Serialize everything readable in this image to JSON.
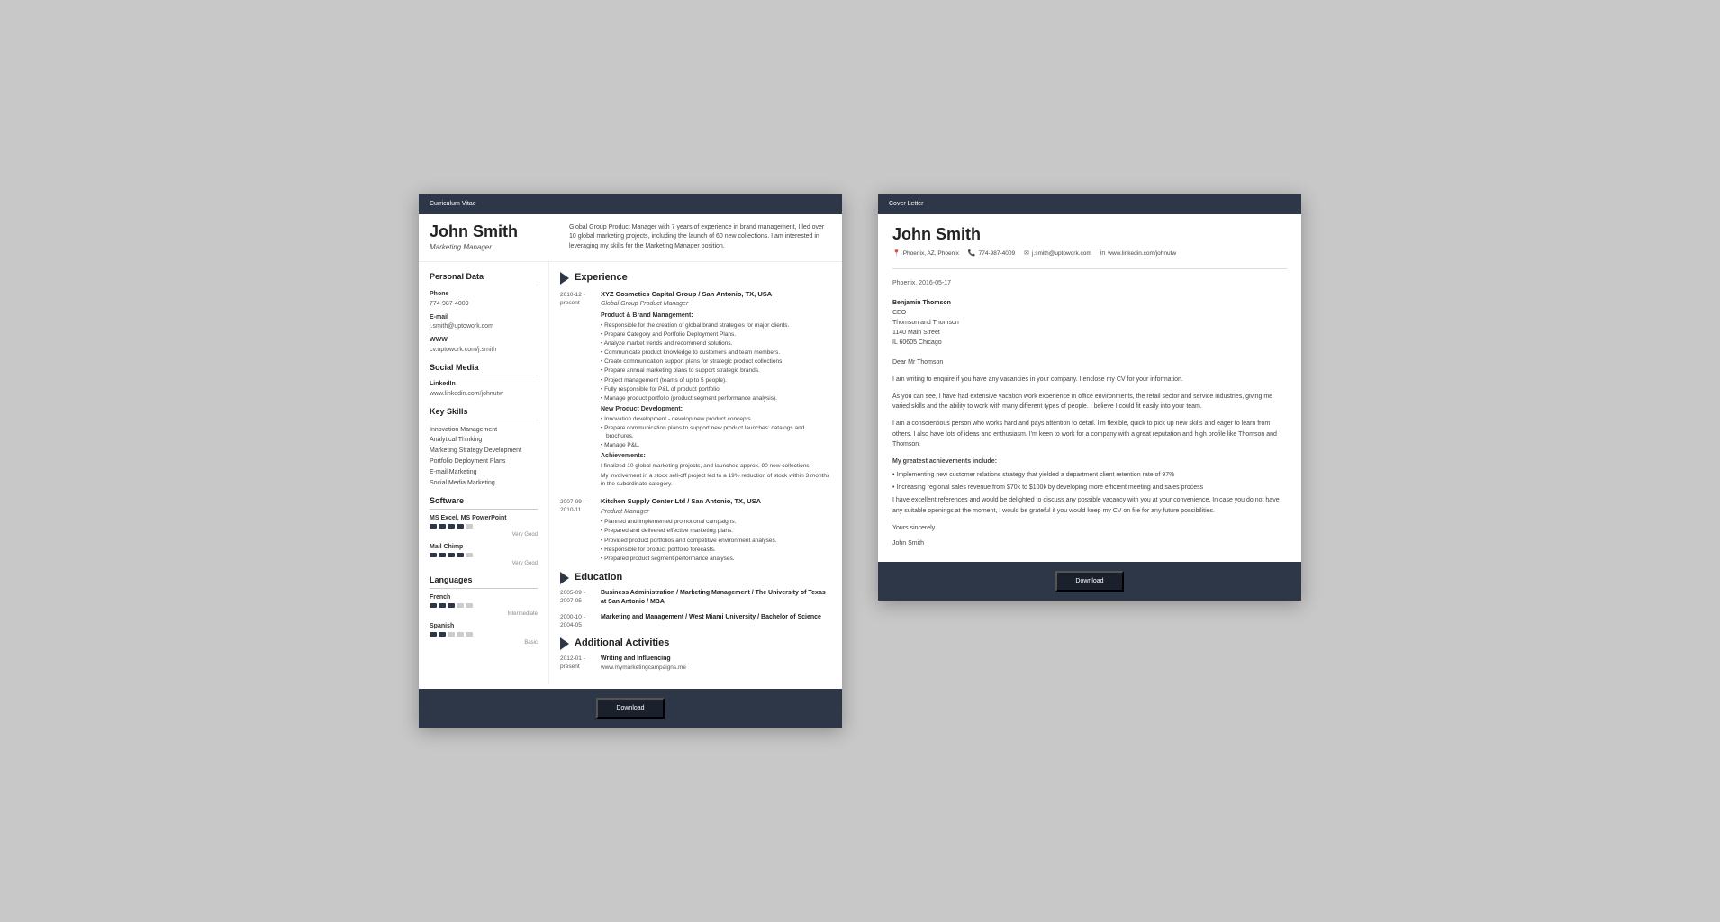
{
  "cv": {
    "header_bar": "Curriculum Vitae",
    "name": "John Smith",
    "title": "Marketing Manager",
    "summary": "Global Group Product Manager with 7 years of experience in brand management, I led over 10 global marketing projects, including the launch of 60 new collections. I am interested in leveraging my skills for the Marketing Manager position.",
    "personal_data": {
      "section_title": "Personal Data",
      "phone_label": "Phone",
      "phone": "774-987-4009",
      "email_label": "E-mail",
      "email": "j.smith@uptowork.com",
      "www_label": "WWW",
      "www": "cv.uptowork.com/j.smith"
    },
    "social_media": {
      "section_title": "Social Media",
      "linkedin_label": "LinkedIn",
      "linkedin": "www.linkedin.com/johnutw"
    },
    "key_skills": {
      "section_title": "Key Skills",
      "skills": [
        "Innovation Management",
        "Analytical Thinking",
        "Marketing Strategy Development",
        "Portfolio Deployment Plans",
        "E-mail Marketing",
        "Social Media Marketing"
      ]
    },
    "software": {
      "section_title": "Software",
      "items": [
        {
          "name": "MS Excel, MS PowerPoint",
          "rating": 4,
          "max": 5,
          "label": "Very Good"
        },
        {
          "name": "Mail Chimp",
          "rating": 4,
          "max": 5,
          "label": "Very Good"
        }
      ]
    },
    "languages": {
      "section_title": "Languages",
      "items": [
        {
          "name": "French",
          "rating": 3,
          "max": 5,
          "label": "Intermediate"
        },
        {
          "name": "Spanish",
          "rating": 2,
          "max": 5,
          "label": "Basic"
        }
      ]
    },
    "experience": {
      "section_title": "Experience",
      "entries": [
        {
          "date": "2010-12 - present",
          "company": "XYZ Cosmetics Capital Group / San Antonio, TX, USA",
          "role": "Global Group Product Manager",
          "sections": [
            {
              "label": "Product & Brand Management:",
              "bullets": [
                "• Responsible for the creation of global brand strategies for major clients.",
                "• Prepare Category and Portfolio Deployment Plans.",
                "• Analyze market trends and recommend solutions.",
                "• Communicate product knowledge to customers and team members.",
                "• Create communication support plans for strategic product collections.",
                "• Prepare annual marketing plans to support strategic brands.",
                "• Project management (teams of up to 5 people).",
                "• Fully responsible for P&L of product portfolio.",
                "• Manage product portfolio (product segment performance analysis)."
              ]
            },
            {
              "label": "New Product Development:",
              "bullets": [
                "• Innovation development - develop new product concepts.",
                "• Prepare communication plans to support new product launches: catalogs and brochures.",
                "• Manage P&L."
              ]
            }
          ],
          "achievements_label": "Achievements:",
          "achievements": [
            "I finalized 10 global marketing projects, and launched approx. 90 new collections.",
            "My involvement in a stock sell-off project led to a 19% reduction of stock within 3 months in the subordinate category."
          ]
        },
        {
          "date": "2007-09 - 2010-11",
          "company": "Kitchen Supply Center Ltd / San Antonio, TX, USA",
          "role": "Product Manager",
          "sections": [
            {
              "label": "",
              "bullets": [
                "• Planned and implemented promotional campaigns.",
                "• Prepared and delivered effective marketing plans.",
                "• Provided product portfolios and competitive environment analyses.",
                "• Responsible for product portfolio forecasts.",
                "• Prepared product segment performance analyses."
              ]
            }
          ],
          "achievements_label": "",
          "achievements": []
        }
      ]
    },
    "education": {
      "section_title": "Education",
      "entries": [
        {
          "date": "2005-09 - 2007-05",
          "degree": "Business Administration / Marketing Management / The University of Texas at San Antonio / MBA"
        },
        {
          "date": "2000-10 - 2004-05",
          "degree": "Marketing and Management / West Miami University / Bachelor of Science"
        }
      ]
    },
    "activities": {
      "section_title": "Additional Activities",
      "entries": [
        {
          "date": "2012-01 - present",
          "title": "Writing and Influencing",
          "url": "www.mymarketingcampaigns.me"
        }
      ]
    },
    "footer_button": "Download"
  },
  "cover_letter": {
    "header_bar": "Cover Letter",
    "name": "John Smith",
    "contact": {
      "location": "Phoenix, AZ, Phoenix",
      "phone": "774-987-4009",
      "email": "j.smith@uptowork.com",
      "linkedin": "www.linkedin.com/johnutw"
    },
    "date": "Phoenix, 2016-05-17",
    "recipient": {
      "name": "Benjamin Thomson",
      "title": "CEO",
      "company": "Thomson and Thomson",
      "address": "1140 Main Street",
      "city": "IL 60605 Chicago"
    },
    "salutation": "Dear Mr Thomson",
    "paragraphs": [
      "I am writing to enquire if you have any vacancies in your company. I enclose my CV for your information.",
      "As you can see, I have had extensive vacation work experience in office environments, the retail sector and service industries, giving me varied skills and the ability to work with many different types of people. I believe I could fit easily into your team.",
      "I am a conscientious person who works hard and pays attention to detail. I'm flexible, quick to pick up new skills and eager to learn from others. I also have lots of ideas and enthusiasm. I'm keen to work for a company with a great reputation and high profile like Thomson and Thomson."
    ],
    "achievements_title": "My greatest achievements include:",
    "achievements": [
      "• Implementing new customer relations strategy that yielded a department client retention rate of 97%",
      "• Increasing regional sales revenue from $70k to $100k by developing more efficient meeting and sales process"
    ],
    "closing_paragraph": "I have excellent references and would be delighted to discuss any possible vacancy with you at your convenience. In case you do not have any suitable openings at the moment, I would be grateful if you would keep my CV on file for any future possibilities.",
    "closing": "Yours sincerely",
    "signature": "John Smith",
    "footer_button": "Download"
  }
}
